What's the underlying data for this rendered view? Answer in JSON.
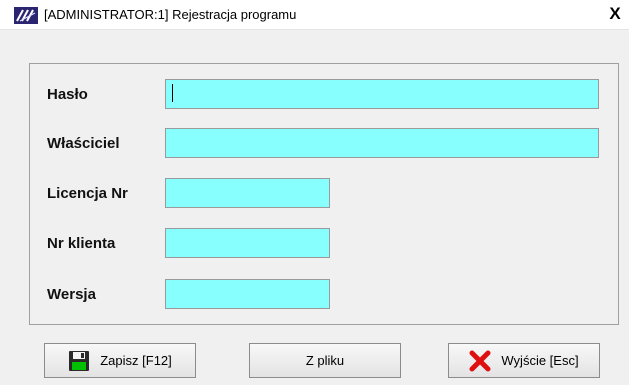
{
  "window": {
    "title": "[ADMINISTRATOR:1]  Rejestracja programu",
    "close_glyph": "X"
  },
  "fields": {
    "haslo": {
      "label": "Hasło",
      "value": ""
    },
    "wlasciciel": {
      "label": "Właściciel",
      "value": ""
    },
    "licencja": {
      "label": "Licencja Nr",
      "value": ""
    },
    "nr_klienta": {
      "label": "Nr klienta",
      "value": ""
    },
    "wersja": {
      "label": "Wersja",
      "value": ""
    }
  },
  "buttons": {
    "save": {
      "label": "Zapisz  [F12]",
      "icon": "floppy-disk-icon"
    },
    "from_file": {
      "label": "Z pliku"
    },
    "exit": {
      "label": "Wyjście  [Esc]",
      "icon": "red-x-icon"
    }
  },
  "colors": {
    "input_bg": "#88ffff",
    "exit_icon": "#e01010",
    "save_icon_accent": "#00c000"
  }
}
